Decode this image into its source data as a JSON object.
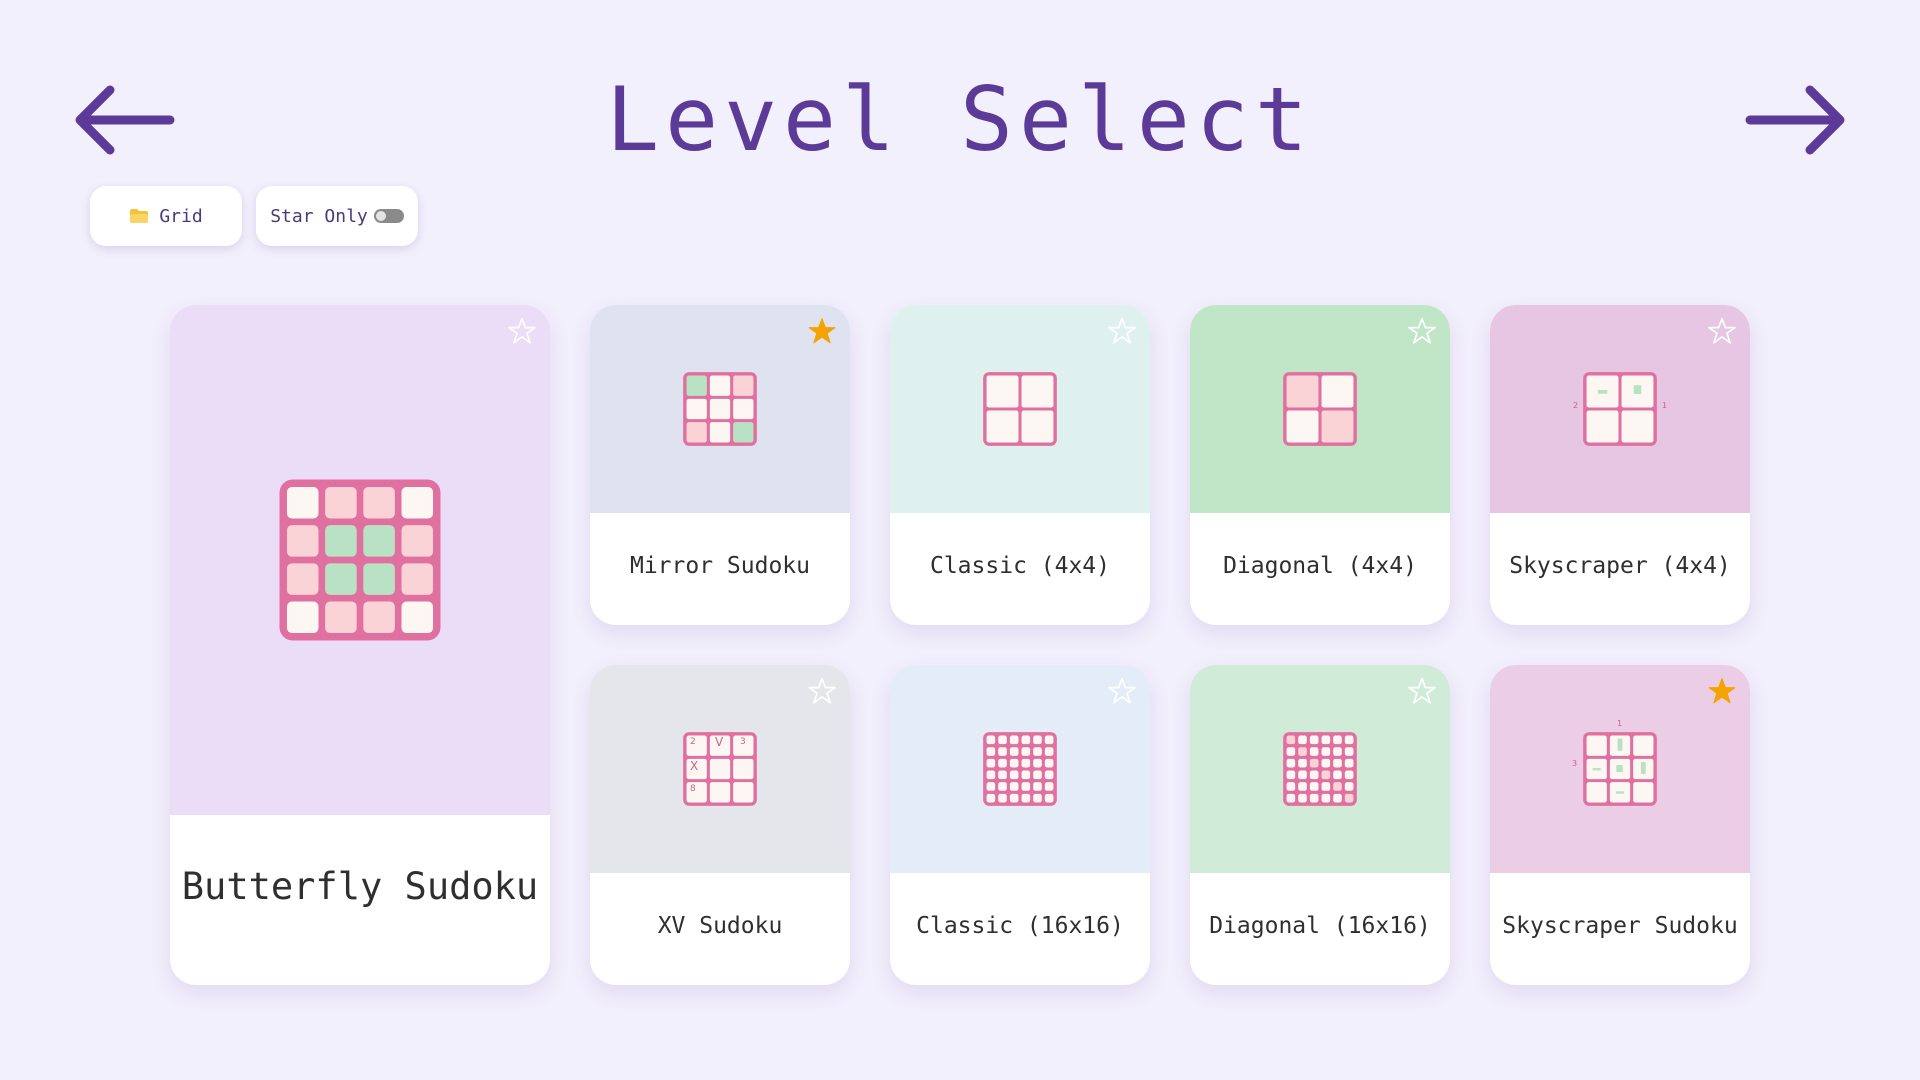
{
  "header": {
    "title": "Level Select",
    "back_icon": "arrow-left-icon",
    "next_icon": "arrow-right-icon",
    "accent_color": "#5c3b98"
  },
  "toolbar": {
    "grid_label": "Grid",
    "grid_icon": "folder-icon",
    "star_only_label": "Star Only",
    "star_only_enabled": false
  },
  "levels": [
    {
      "name": "Butterfly Sudoku",
      "starred": false,
      "bg": "#ebdcf7",
      "icon": "butterfly-grid-icon"
    },
    {
      "name": "Mirror Sudoku",
      "starred": true,
      "bg": "#dfe3ef",
      "icon": "mirror-grid-icon"
    },
    {
      "name": "Classic (4x4)",
      "starred": false,
      "bg": "#dff1ef",
      "icon": "classic-4x4-icon"
    },
    {
      "name": "Diagonal (4x4)",
      "starred": false,
      "bg": "#c1e6c7",
      "icon": "diagonal-4x4-icon"
    },
    {
      "name": "Skyscraper (4x4)",
      "starred": false,
      "bg": "#e6c6e2",
      "icon": "skyscraper-4x4-icon"
    },
    {
      "name": "XV Sudoku",
      "starred": false,
      "bg": "#e5e5ec",
      "icon": "xv-grid-icon"
    },
    {
      "name": "Classic (16x16)",
      "starred": false,
      "bg": "#e3ecf7",
      "icon": "classic-16x16-icon"
    },
    {
      "name": "Diagonal (16x16)",
      "starred": false,
      "bg": "#d0ecd8",
      "icon": "diagonal-16x16-icon"
    },
    {
      "name": "Skyscraper Sudoku",
      "starred": true,
      "bg": "#ebcde6",
      "icon": "skyscraper-grid-icon"
    }
  ],
  "preview_text": {
    "skyscraper_4x4_left": "2",
    "skyscraper_4x4_right": "1",
    "xv_cell_1": "2",
    "xv_cell_2": "V",
    "xv_cell_3": "3",
    "xv_cell_4": "X",
    "xv_cell_5": "8",
    "skyscraper_top": "1",
    "skyscraper_left": "3"
  },
  "colors": {
    "star_filled": "#f5a300",
    "star_outline": "#ffffff",
    "grid_border": "#e0709f",
    "cell_cream": "#fcf7f2",
    "cell_pink": "#f9d3d6",
    "cell_green": "#b9e2c5"
  }
}
